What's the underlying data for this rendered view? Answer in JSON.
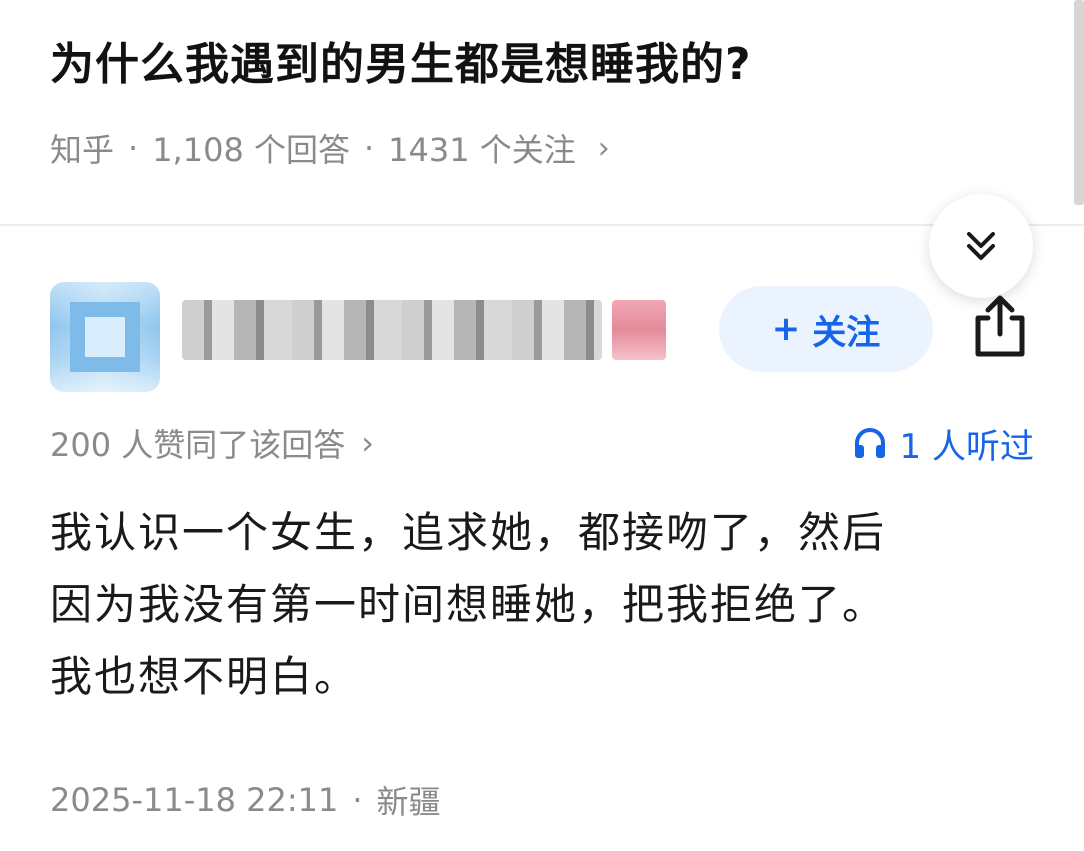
{
  "question": {
    "title": "为什么我遇到的男生都是想睡我的?",
    "source": "知乎",
    "answers_count": "1,108 个回答",
    "followers_count": "1431 个关注",
    "separator": "·",
    "chevron": "›"
  },
  "answer": {
    "follow_label": "关注",
    "follow_plus": "+",
    "endorse_text": "200 人赞同了该回答",
    "endorse_chevron": "›",
    "listen_text": "1 人听过",
    "content_lines": [
      "我认识一个女生，追求她，都接吻了，然后",
      "因为我没有第一时间想睡她，把我拒绝了。",
      "我也想不明白。"
    ],
    "timestamp": "2025-11-18 22:11",
    "location": "新疆",
    "footer_separator": "·"
  },
  "colors": {
    "accent": "#1565e6",
    "follow_bg": "#ebf3fe",
    "muted_text": "#8a8a8a"
  },
  "icons": [
    "expand-down-icon",
    "share-icon",
    "headphones-icon",
    "chevron-right-icon"
  ]
}
